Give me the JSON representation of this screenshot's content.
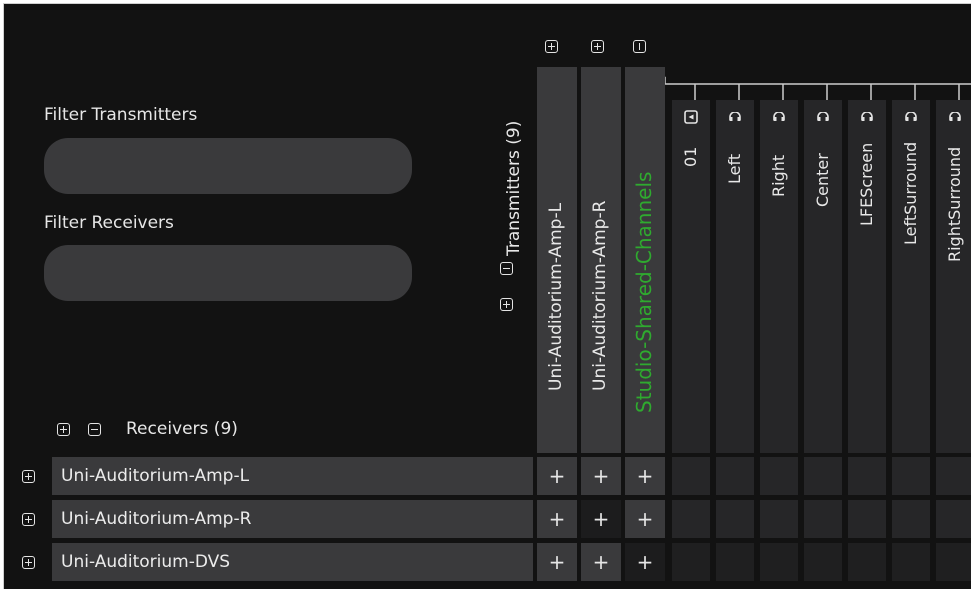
{
  "filters": {
    "transmitters_label": "Filter Transmitters",
    "receivers_label": "Filter Receivers",
    "transmitters_value": "",
    "receivers_value": ""
  },
  "transmitters": {
    "label": "Transmitters (9)",
    "columns": [
      {
        "label": "Uni-Auditorium-Amp-L",
        "color": "#e8e8e8"
      },
      {
        "label": "Uni-Auditorium-Amp-R",
        "color": "#e8e8e8"
      },
      {
        "label": "Studio-Shared-Channels",
        "color": "#2faa2f"
      }
    ],
    "channels": [
      {
        "label": "01",
        "icon": "media-icon"
      },
      {
        "label": "Left",
        "icon": "headphones-icon"
      },
      {
        "label": "Right",
        "icon": "headphones-icon"
      },
      {
        "label": "Center",
        "icon": "headphones-icon"
      },
      {
        "label": "LFEScreen",
        "icon": "headphones-icon"
      },
      {
        "label": "LeftSurround",
        "icon": "headphones-icon"
      },
      {
        "label": "RightSurround",
        "icon": "headphones-icon"
      }
    ]
  },
  "receivers": {
    "label": "Receivers (9)",
    "rows": [
      {
        "label": "Uni-Auditorium-Amp-L",
        "cells": [
          "+",
          "+",
          "+"
        ]
      },
      {
        "label": "Uni-Auditorium-Amp-R",
        "cells": [
          "+",
          "+",
          "+"
        ]
      },
      {
        "label": "Uni-Auditorium-DVS",
        "cells": [
          "+",
          "+",
          "+"
        ]
      }
    ]
  },
  "colors": {
    "background": "#121212",
    "panel": "#3a3a3c",
    "accent_green": "#2faa2f"
  }
}
